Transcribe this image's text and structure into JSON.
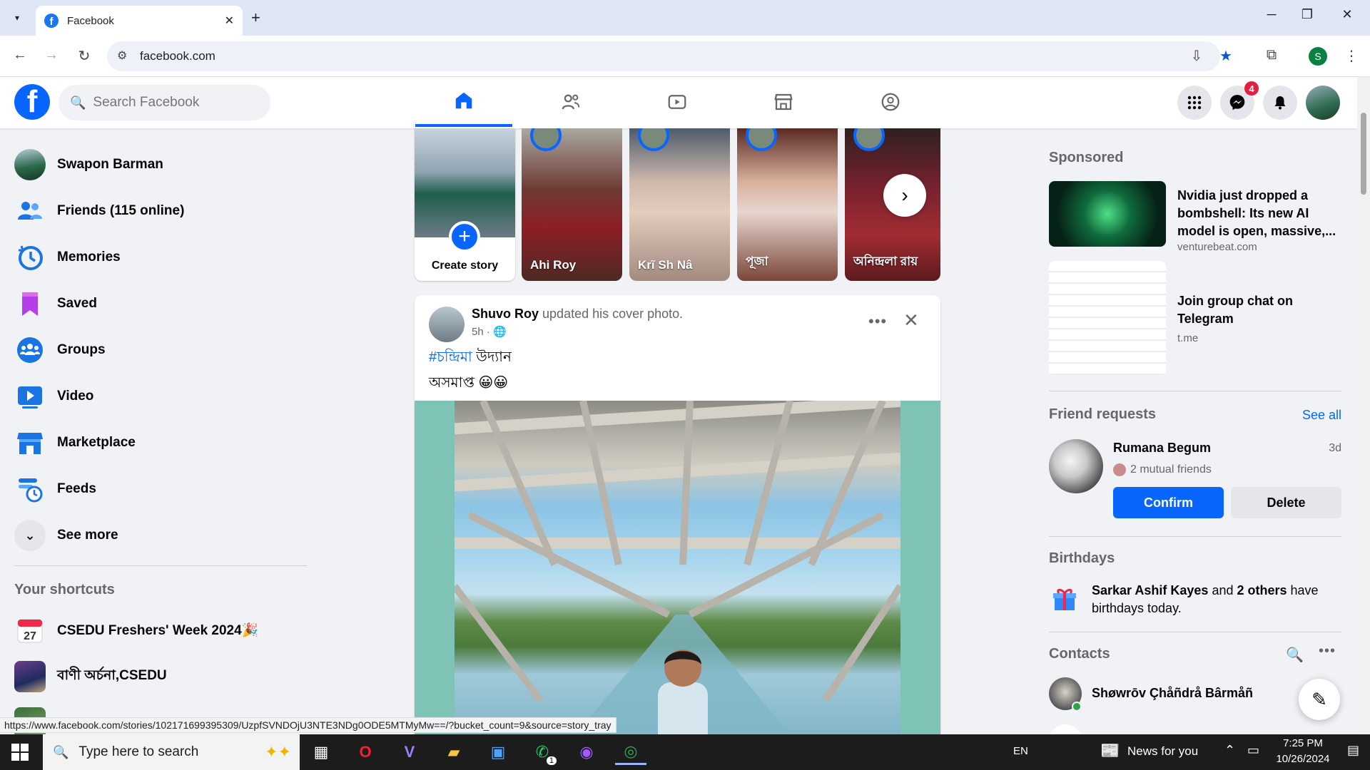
{
  "browser": {
    "tab_title": "Facebook",
    "url": "facebook.com",
    "status_url": "https://www.facebook.com/stories/102171699395309/UzpfSVNDOjU3NTE3NDg0ODE5MTMyMw==/?bucket_count=9&source=story_tray",
    "profile_initial": "S"
  },
  "header": {
    "logo": "f",
    "search_placeholder": "Search Facebook",
    "messenger_badge": "4"
  },
  "left_nav": {
    "items": [
      {
        "label": "Swapon Barman",
        "icon": "profile-avatar"
      },
      {
        "label": "Friends (115 online)",
        "icon": "friends-icon"
      },
      {
        "label": "Memories",
        "icon": "memories-icon"
      },
      {
        "label": "Saved",
        "icon": "saved-icon"
      },
      {
        "label": "Groups",
        "icon": "groups-icon"
      },
      {
        "label": "Video",
        "icon": "video-icon"
      },
      {
        "label": "Marketplace",
        "icon": "marketplace-icon"
      },
      {
        "label": "Feeds",
        "icon": "feeds-icon"
      },
      {
        "label": "See more",
        "icon": "chevron-down-icon"
      }
    ],
    "shortcuts_heading": "Your shortcuts",
    "shortcuts": [
      {
        "label": "CSEDU Freshers' Week 2024🎉",
        "calendar_day": "27"
      },
      {
        "label": "বাণী অর্চনা,CSEDU"
      }
    ]
  },
  "stories": {
    "create_label": "Create story",
    "items": [
      {
        "name": "Ahi Roy"
      },
      {
        "name": "Krĩ Sh Nâ"
      },
      {
        "name": "পূজা"
      },
      {
        "name": "অনিন্দ্রলা রায়"
      }
    ]
  },
  "post": {
    "author": "Shuvo Roy",
    "action": "updated his cover photo.",
    "time": "5h ·",
    "hashtag": "#চন্দ্রিমা",
    "text_line1_rest": " উদ্যান",
    "text_line2": "অসমাপ্ত 😀😀"
  },
  "right": {
    "sponsored_heading": "Sponsored",
    "ads": [
      {
        "title": "Nvidia just dropped a bombshell: Its new AI model is open, massive,...",
        "url": "venturebeat.com"
      },
      {
        "title": "Join group chat on Telegram",
        "url": "t.me"
      }
    ],
    "friend_requests_heading": "Friend requests",
    "see_all": "See all",
    "request": {
      "name": "Rumana Begum",
      "age": "3d",
      "mutual": "2 mutual friends",
      "confirm": "Confirm",
      "delete": "Delete"
    },
    "birthdays_heading": "Birthdays",
    "birthday": {
      "name1": "Sarkar Ashif Kayes",
      "mid": " and ",
      "name2": "2 others",
      "end": " have birthdays today."
    },
    "contacts_heading": "Contacts",
    "contacts": [
      {
        "name": "Shøwrōv Çhåñdrå Bârmåñ"
      }
    ]
  },
  "taskbar": {
    "search_placeholder": "Type here to search",
    "language": "EN",
    "news": "News for you",
    "time": "7:25 PM",
    "date": "10/26/2024",
    "whatsapp_badge": "1"
  },
  "colors": {
    "fb_blue": "#0866ff",
    "badge_red": "#e41e3f",
    "bg": "#f0f2f5"
  }
}
